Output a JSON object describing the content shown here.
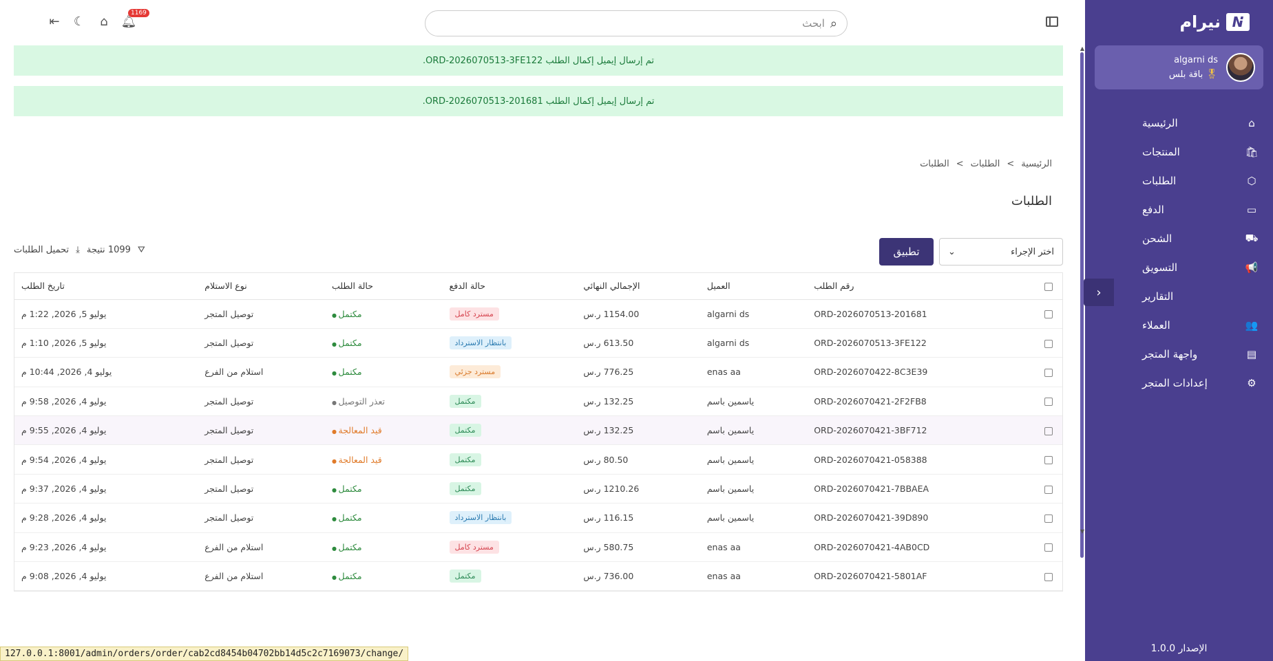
{
  "brand": {
    "name": "نيرام",
    "logo_letter": "N"
  },
  "user": {
    "name": "algarni ds",
    "plan": "باقة بلس"
  },
  "nav": [
    {
      "label": "الرئيسية",
      "icon": "home-icon",
      "glyph": "⌂"
    },
    {
      "label": "المنتجات",
      "icon": "bag-icon",
      "glyph": "🛍"
    },
    {
      "label": "الطلبات",
      "icon": "box-icon",
      "glyph": "⬡"
    },
    {
      "label": "الدفع",
      "icon": "card-icon",
      "glyph": "▭"
    },
    {
      "label": "الشحن",
      "icon": "truck-icon",
      "glyph": "⛟"
    },
    {
      "label": "التسويق",
      "icon": "megaphone-icon",
      "glyph": "📢"
    },
    {
      "label": "التقارير",
      "icon": "chart-icon",
      "glyph": ""
    },
    {
      "label": "العملاء",
      "icon": "users-icon",
      "glyph": "👥"
    },
    {
      "label": "واجهة المتجر",
      "icon": "storefront-icon",
      "glyph": "▤"
    },
    {
      "label": "إعدادات المتجر",
      "icon": "gear-icon",
      "glyph": "⚙"
    }
  ],
  "version": "الإصدار 1.0.0",
  "search": {
    "placeholder": "ابحث"
  },
  "notifications": {
    "count": "1169"
  },
  "alerts": [
    "تم إرسال إيميل إكمال الطلب ORD-2026070513-3FE122.",
    "تم إرسال إيميل إكمال الطلب ORD-2026070513-201681."
  ],
  "breadcrumb": [
    "الرئيسية",
    ">",
    "الطلبات",
    ">",
    "الطلبات"
  ],
  "page_title": "الطلبات",
  "toolbar": {
    "action_placeholder": "اختر الإجراء",
    "apply_label": "تطبيق",
    "results": "1099 نتيجة",
    "download": "تحميل الطلبات"
  },
  "table": {
    "headers": [
      "رقم الطلب",
      "العميل",
      "الإجمالي النهائي",
      "حالة الدفع",
      "حالة الطلب",
      "نوع الاستلام",
      "تاريخ الطلب"
    ],
    "rows": [
      {
        "id": "ORD-2026070513-201681",
        "customer": "algarni ds",
        "total": "1154.00 ر.س",
        "payment": "مسترد كامل",
        "pay_bg": "#fde2e4",
        "pay_fg": "#d64550",
        "status": "مكتمل",
        "status_color": "#2e8b3e",
        "delivery": "توصيل المتجر",
        "date": "يوليو 5, 2026, 1:22 م"
      },
      {
        "id": "ORD-2026070513-3FE122",
        "customer": "algarni ds",
        "total": "613.50 ر.س",
        "payment": "بانتظار الاسترداد",
        "pay_bg": "#def0fb",
        "pay_fg": "#2a7ab0",
        "status": "مكتمل",
        "status_color": "#2e8b3e",
        "delivery": "توصيل المتجر",
        "date": "يوليو 5, 2026, 1:10 م"
      },
      {
        "id": "ORD-2026070422-8C3E39",
        "customer": "enas aa",
        "total": "776.25 ر.س",
        "payment": "مسترد جزئي",
        "pay_bg": "#fdebd8",
        "pay_fg": "#d97a2b",
        "status": "مكتمل",
        "status_color": "#2e8b3e",
        "delivery": "استلام من الفرع",
        "date": "يوليو 4, 2026, 10:44 م"
      },
      {
        "id": "ORD-2026070421-2F2FB8",
        "customer": "ياسمين باسم",
        "total": "132.25 ر.س",
        "payment": "مكتمل",
        "pay_bg": "#d8f5e4",
        "pay_fg": "#2e8b57",
        "status": "تعذر التوصيل",
        "status_color": "#777777",
        "delivery": "توصيل المتجر",
        "date": "يوليو 4, 2026, 9:58 م"
      },
      {
        "id": "ORD-2026070421-3BF712",
        "customer": "ياسمين باسم",
        "total": "132.25 ر.س",
        "payment": "مكتمل",
        "pay_bg": "#d8f5e4",
        "pay_fg": "#2e8b57",
        "status": "قيد المعالجة",
        "status_color": "#e07b2a",
        "delivery": "توصيل المتجر",
        "date": "يوليو 4, 2026, 9:55 م"
      },
      {
        "id": "ORD-2026070421-058388",
        "customer": "ياسمين باسم",
        "total": "80.50 ر.س",
        "payment": "مكتمل",
        "pay_bg": "#d8f5e4",
        "pay_fg": "#2e8b57",
        "status": "قيد المعالجة",
        "status_color": "#e07b2a",
        "delivery": "توصيل المتجر",
        "date": "يوليو 4, 2026, 9:54 م"
      },
      {
        "id": "ORD-2026070421-7BBAEA",
        "customer": "ياسمين باسم",
        "total": "1210.26 ر.س",
        "payment": "مكتمل",
        "pay_bg": "#d8f5e4",
        "pay_fg": "#2e8b57",
        "status": "مكتمل",
        "status_color": "#2e8b3e",
        "delivery": "توصيل المتجر",
        "date": "يوليو 4, 2026, 9:37 م"
      },
      {
        "id": "ORD-2026070421-39D890",
        "customer": "ياسمين باسم",
        "total": "116.15 ر.س",
        "payment": "بانتظار الاسترداد",
        "pay_bg": "#def0fb",
        "pay_fg": "#2a7ab0",
        "status": "مكتمل",
        "status_color": "#2e8b3e",
        "delivery": "توصيل المتجر",
        "date": "يوليو 4, 2026, 9:28 م"
      },
      {
        "id": "ORD-2026070421-4AB0CD",
        "customer": "enas aa",
        "total": "580.75 ر.س",
        "payment": "مسترد كامل",
        "pay_bg": "#fde2e4",
        "pay_fg": "#d64550",
        "status": "مكتمل",
        "status_color": "#2e8b3e",
        "delivery": "استلام من الفرع",
        "date": "يوليو 4, 2026, 9:23 م"
      },
      {
        "id": "ORD-2026070421-5801AF",
        "customer": "enas aa",
        "total": "736.00 ر.س",
        "payment": "مكتمل",
        "pay_bg": "#d8f5e4",
        "pay_fg": "#2e8b57",
        "status": "مكتمل",
        "status_color": "#2e8b3e",
        "delivery": "استلام من الفرع",
        "date": "يوليو 4, 2026, 9:08 م"
      }
    ]
  },
  "status_url": "127.0.0.1:8001/admin/orders/order/cab2cd8454b04702bb14d5c2c7169073/change/"
}
